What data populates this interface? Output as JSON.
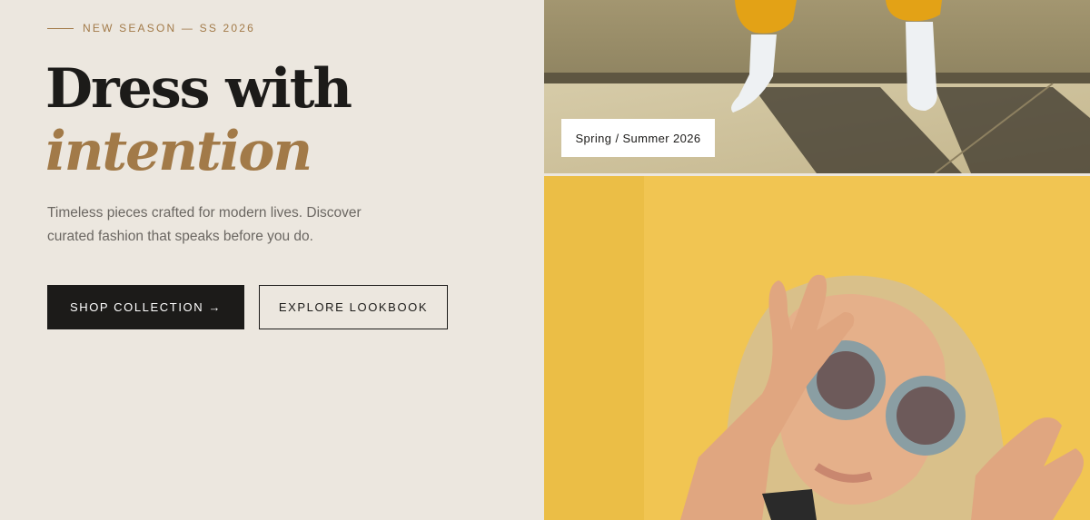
{
  "hero": {
    "eyebrow": "NEW SEASON — SS 2026",
    "headline_line1": "Dress with",
    "headline_line2": "intention",
    "description": "Timeless pieces crafted for modern lives. Discover curated fashion that speaks before you do.",
    "primary_button": "SHOP COLLECTION →",
    "secondary_button": "EXPLORE LOOKBOOK"
  },
  "gallery": {
    "caption": "Spring / Summer 2026"
  },
  "colors": {
    "background": "#ece7df",
    "accent": "#a27a48",
    "dark": "#1c1b19",
    "text_muted": "#6b6762"
  }
}
